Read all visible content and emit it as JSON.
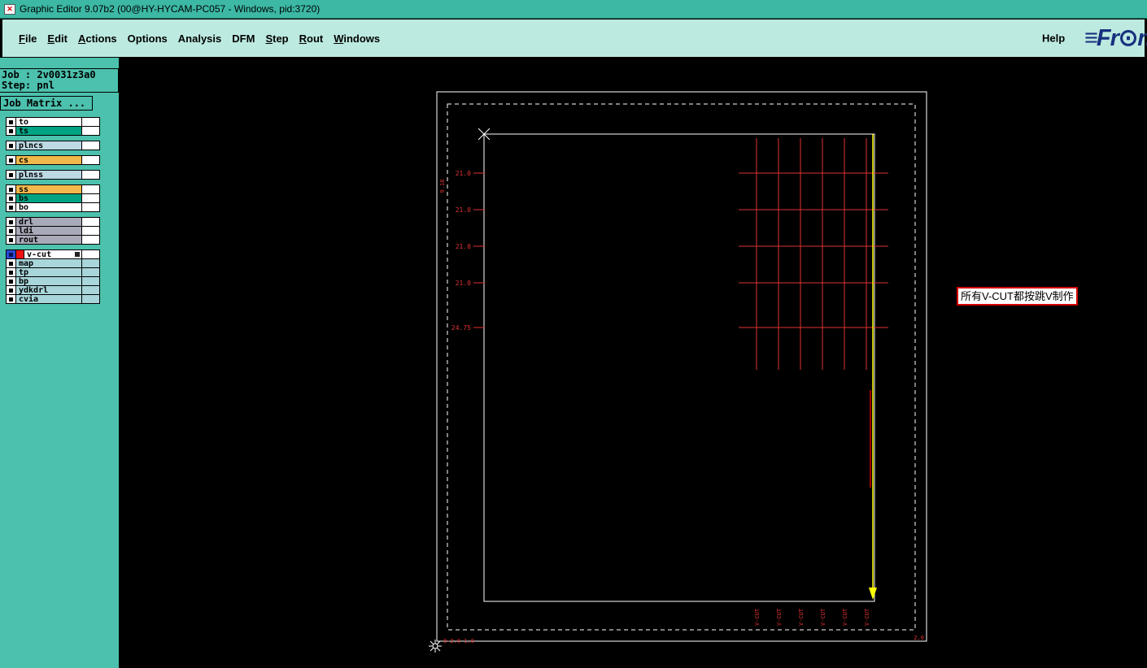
{
  "window": {
    "title": "Graphic Editor 9.07b2 (00@HY-HYCAM-PC057 - Windows, pid:3720)"
  },
  "theme": {
    "titlebar_teal": "#3CB8A4",
    "menu_teal": "#BCEAE0",
    "sidebar_teal": "#4CC1AD",
    "canvas_bg": "#000000",
    "grid_red": "#E03232",
    "vcut_yellow": "#FFFF00",
    "logo_blue": "#17307E"
  },
  "menu": {
    "items": [
      {
        "label": "File",
        "underline": 0
      },
      {
        "label": "Edit",
        "underline": 0
      },
      {
        "label": "Actions",
        "underline": 0
      },
      {
        "label": "Options",
        "underline": null
      },
      {
        "label": "Analysis",
        "underline": null
      },
      {
        "label": "DFM",
        "underline": null
      },
      {
        "label": "Step",
        "underline": 0
      },
      {
        "label": "Rout",
        "underline": 0
      },
      {
        "label": "Windows",
        "underline": 0
      }
    ],
    "help": "Help",
    "logo": {
      "bars": "≡",
      "fr": "Fr",
      "o": "⊙",
      "nt": "nt"
    }
  },
  "sidebar": {
    "job_label": "Job : 2v0031z3a0",
    "step_label": "Step: pnl",
    "job_matrix_button": "Job Matrix ...",
    "layers": [
      {
        "name": "to",
        "color": "#FFFFFF",
        "tail_white": true
      },
      {
        "name": "ts",
        "color": "#00A383",
        "tail_white": true
      },
      {
        "name": "plncs",
        "color": "#BCD9E4",
        "tail_white": true,
        "gap_before": true
      },
      {
        "name": "cs",
        "color": "#F2B84B",
        "tail_white": true,
        "gap_before": true
      },
      {
        "name": "plnss",
        "color": "#BCD9E4",
        "tail_white": true,
        "gap_before": true
      },
      {
        "name": "ss",
        "color": "#F2B84B",
        "tail_white": true,
        "gap_before": true
      },
      {
        "name": "bs",
        "color": "#00A383",
        "tail_white": true
      },
      {
        "name": "bo",
        "color": "#FFFFFF",
        "tail_white": true
      },
      {
        "name": "drl",
        "color": "#A9AAB9",
        "tail_white": true,
        "gap_before": true
      },
      {
        "name": "ldi",
        "color": "#A9AAB9",
        "tail_white": true
      },
      {
        "name": "rout",
        "color": "#A9AAB9",
        "tail_white": true
      },
      {
        "name": "v-cut",
        "color": "#FFFFFF",
        "tail_white": true,
        "gap_before": true,
        "active": true,
        "swatch": "#EE1111",
        "marker": true
      },
      {
        "name": "map",
        "color": "#A8D6DA",
        "tail_white": false
      },
      {
        "name": "tp",
        "color": "#A8D6DA",
        "tail_white": false
      },
      {
        "name": "bp",
        "color": "#A8D6DA",
        "tail_white": false
      },
      {
        "name": "ydkdrl",
        "color": "#A8D6DA",
        "tail_white": false
      },
      {
        "name": "cvia",
        "color": "#A8D6DA",
        "tail_white": false
      }
    ]
  },
  "canvas": {
    "annotation": {
      "text": "所有V-CUT都按跳V制作",
      "border_color": "#D40000"
    },
    "dim_labels": [
      "21.0",
      "21.0",
      "21.0",
      "21.0",
      "24.75"
    ],
    "left_vertical_label": "9.18",
    "origin_label": "0-2.0 1.0",
    "corner_label": "2.0",
    "vcut_labels": [
      "V-CUT",
      "V-CUT",
      "V-CUT",
      "V-CUT",
      "V-CUT",
      "V-CUT"
    ]
  }
}
